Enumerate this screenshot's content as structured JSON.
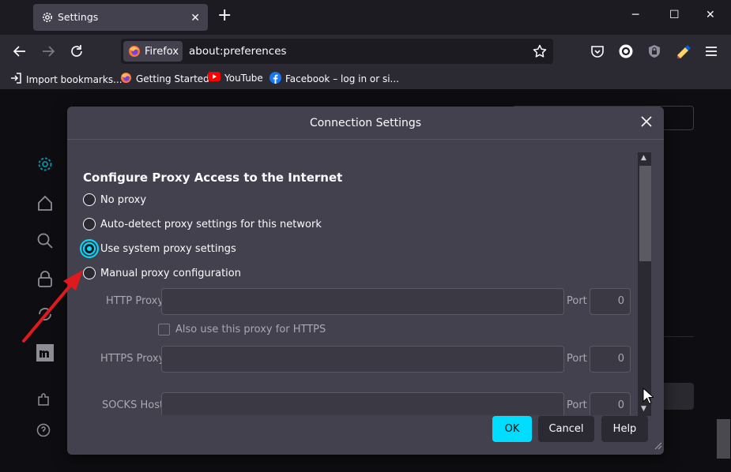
{
  "tab": {
    "title": "Settings",
    "close": "✕"
  },
  "new_tab": "+",
  "window_controls": {
    "minimize": "─",
    "maximize": "☐",
    "close": "✕"
  },
  "urlbar": {
    "identity": "Firefox",
    "url": "about:preferences"
  },
  "bookmarks": [
    {
      "label": "Import bookmarks..."
    },
    {
      "label": "Getting Started"
    },
    {
      "label": "YouTube"
    },
    {
      "label": "Facebook – log in or si..."
    }
  ],
  "dialog": {
    "title": "Connection Settings",
    "heading": "Configure Proxy Access to the Internet",
    "options": [
      {
        "label": "No proxy",
        "selected": false
      },
      {
        "label": "Auto-detect proxy settings for this network",
        "selected": false
      },
      {
        "label": "Use system proxy settings",
        "selected": true
      },
      {
        "label": "Manual proxy configuration",
        "selected": false
      }
    ],
    "http_proxy_label": "HTTP Proxy",
    "http_port_label": "Port",
    "http_port_value": "0",
    "also_https_label": "Also use this proxy for HTTPS",
    "https_proxy_label": "HTTPS Proxy",
    "https_port_label": "Port",
    "https_port_value": "0",
    "socks_host_label": "SOCKS Host",
    "socks_port_label": "Port",
    "socks_port_value": "0",
    "buttons": {
      "ok": "OK",
      "cancel": "Cancel",
      "help": "Help"
    }
  },
  "colors": {
    "accent": "#00ddff",
    "annotation_arrow": "#e0191e"
  }
}
